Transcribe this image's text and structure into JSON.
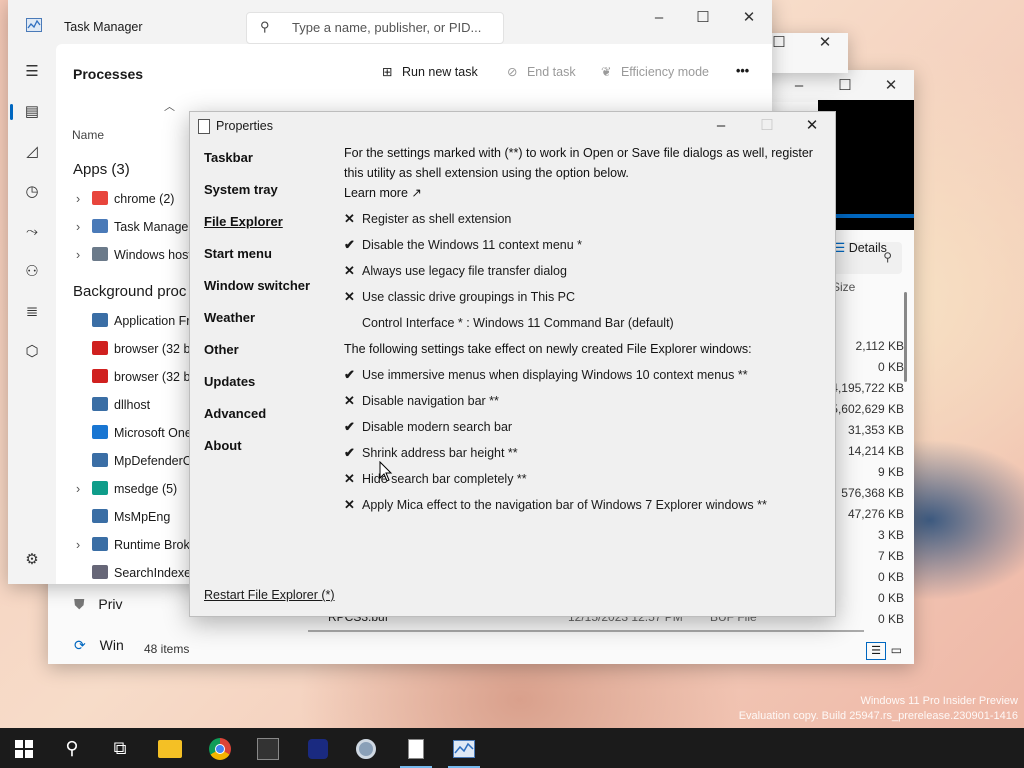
{
  "desktop": {
    "watermark_line1": "Windows 11 Pro Insider Preview",
    "watermark_line2": "Evaluation copy. Build 25947.rs_prerelease.230901-1416"
  },
  "explorer": {
    "details_label": "Details",
    "size_header": "Size",
    "sizes": [
      "2,112 KB",
      "0 KB",
      "4,195,722 KB",
      "5,602,629 KB",
      "31,353 KB",
      "14,214 KB",
      "9 KB",
      "576,368 KB",
      "47,276 KB",
      "3 KB",
      "7 KB",
      "0 KB",
      "0 KB",
      "0 KB"
    ],
    "status": "48 items",
    "partial_row": "RPCS3.buf",
    "partial_date": "12/15/2023 12:57 PM",
    "partial_type": "BUF File",
    "left_items": [
      "Priv",
      "Win"
    ]
  },
  "taskmgr": {
    "title": "Task Manager",
    "search_placeholder": "Type a name, publisher, or PID...",
    "section": "Processes",
    "run_new_task": "Run new task",
    "end_task": "End task",
    "efficiency_mode": "Efficiency mode",
    "more": "•••",
    "col_name": "Name",
    "apps_header": "Apps (3)",
    "bg_header": "Background proc",
    "apps": [
      {
        "name": "chrome (2)",
        "expandable": true,
        "color": "#e8453c"
      },
      {
        "name": "Task Manager",
        "expandable": true,
        "color": "#4a7ab8"
      },
      {
        "name": "Windows host",
        "expandable": true,
        "color": "#6b7a8a"
      }
    ],
    "background": [
      {
        "name": "Application Fr",
        "expandable": false,
        "color": "#3a6ea5"
      },
      {
        "name": "browser (32 bi",
        "expandable": false,
        "color": "#d0201f"
      },
      {
        "name": "browser (32 bi",
        "expandable": false,
        "color": "#d0201f"
      },
      {
        "name": "dllhost",
        "expandable": false,
        "color": "#3a6ea5"
      },
      {
        "name": "Microsoft One",
        "expandable": false,
        "color": "#1976d2"
      },
      {
        "name": "MpDefenderC",
        "expandable": false,
        "color": "#3a6ea5"
      },
      {
        "name": "msedge (5)",
        "expandable": true,
        "color": "#0f9d8a"
      },
      {
        "name": "MsMpEng",
        "expandable": false,
        "color": "#3a6ea5"
      },
      {
        "name": "Runtime Brok",
        "expandable": true,
        "color": "#3a6ea5"
      },
      {
        "name": "SearchIndexer",
        "expandable": false,
        "color": "#667"
      }
    ]
  },
  "props": {
    "title": "Properties",
    "nav": [
      "Taskbar",
      "System tray",
      "File Explorer",
      "Start menu",
      "Window switcher",
      "Weather",
      "Other",
      "Updates",
      "Advanced",
      "About"
    ],
    "active_nav": "File Explorer",
    "intro_line1": "For the settings marked with (**) to work in Open or Save file dialogs as well, register",
    "intro_line2": "this utility as shell extension using the option below.",
    "learn_more": "Learn more ↗",
    "options_a": [
      {
        "mark": "✕",
        "label": "Register as shell extension"
      },
      {
        "mark": "✔",
        "label": "Disable the Windows 11 context menu *"
      },
      {
        "mark": "✕",
        "label": "Always use legacy file transfer dialog"
      },
      {
        "mark": "✕",
        "label": "Use classic drive groupings in This PC"
      },
      {
        "mark": "",
        "label": "Control Interface * : Windows 11 Command Bar (default)"
      }
    ],
    "section_b": "The following settings take effect on newly created File Explorer windows:",
    "options_b": [
      {
        "mark": "✔",
        "label": "Use immersive menus when displaying Windows 10 context menus **"
      },
      {
        "mark": "✕",
        "label": "Disable navigation bar **"
      },
      {
        "mark": "✔",
        "label": "Disable modern search bar"
      },
      {
        "mark": "✔",
        "label": "Shrink address bar height **"
      },
      {
        "mark": "✕",
        "label": "Hide search bar completely **"
      },
      {
        "mark": "✕",
        "label": "Apply Mica effect to the navigation bar of Windows 7 Explorer windows **"
      }
    ],
    "restart": "Restart File Explorer (*)"
  },
  "taskbar": {
    "items": [
      "start-icon",
      "search-icon",
      "task-view-icon",
      "file-explorer-icon",
      "chrome-icon",
      "app-icon-1",
      "app-icon-2",
      "settings-icon",
      "properties-app-icon",
      "task-manager-icon"
    ],
    "active": [
      "properties-app-icon",
      "task-manager-icon"
    ]
  },
  "colors": {
    "accent": "#0067c0",
    "taskbar": "#1b1b1b"
  }
}
